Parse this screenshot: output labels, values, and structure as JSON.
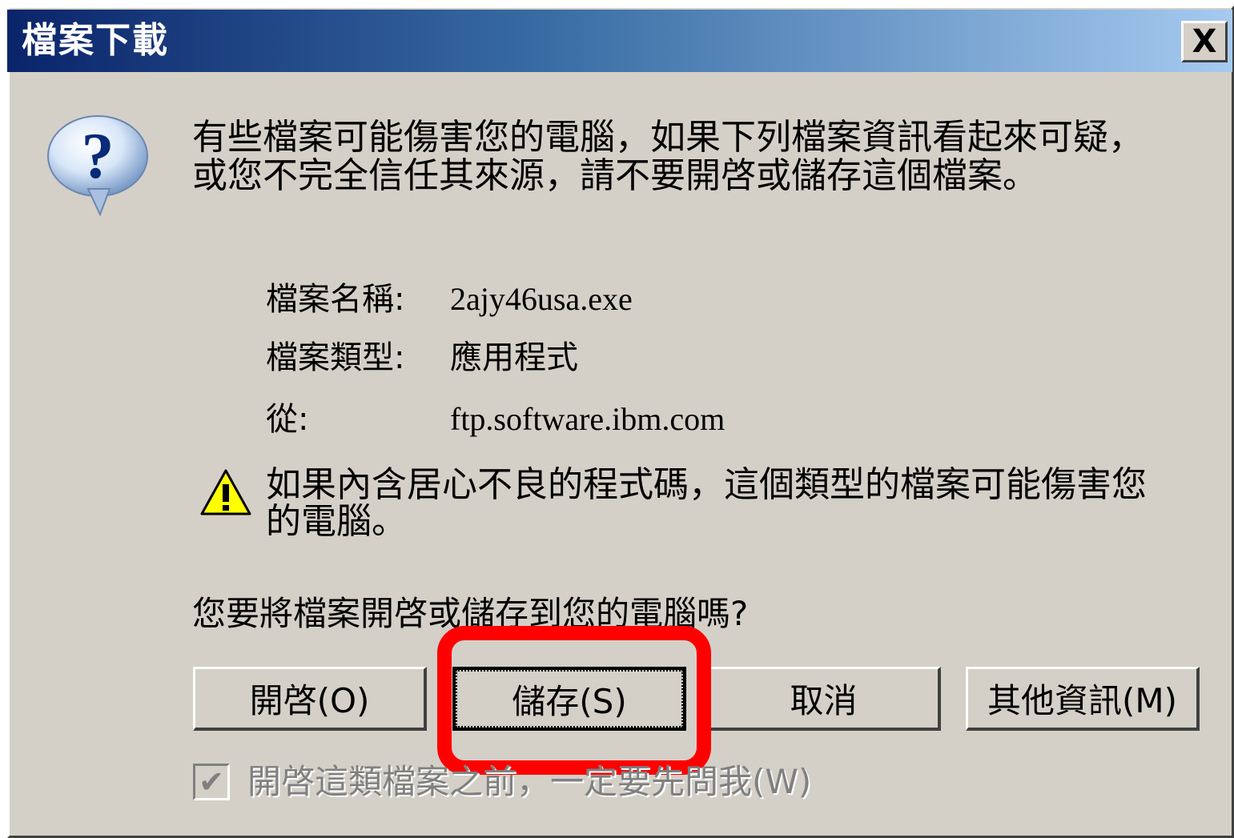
{
  "window": {
    "title": "檔案下載",
    "close_label": "X"
  },
  "intro_text": "有些檔案可能傷害您的電腦，如果下列檔案資訊看起來可疑，或您不完全信任其來源，請不要開啓或儲存這個檔案。",
  "file_info": {
    "name_label": "檔案名稱:",
    "name_value": "2ajy46usa.exe",
    "type_label": "檔案類型:",
    "type_value": "應用程式",
    "from_label": "從:",
    "from_value": "ftp.software.ibm.com"
  },
  "warning_text": "如果內含居心不良的程式碼，這個類型的檔案可能傷害您的電腦。",
  "question_text": "您要將檔案開啓或儲存到您的電腦嗎?",
  "buttons": {
    "open": "開啓(O)",
    "save": "儲存(S)",
    "cancel": "取消",
    "more_info": "其他資訊(M)"
  },
  "checkbox": {
    "label": "開啓這類檔案之前，一定要先問我(W)",
    "checked": true,
    "enabled": false
  },
  "icons": {
    "question": "question-icon",
    "warning": "warning-icon",
    "close": "close-icon"
  },
  "colors": {
    "titlebar_start": "#0a246a",
    "titlebar_end": "#a6caf0",
    "dialog_bg": "#d4d0c8",
    "highlight": "#ff0000"
  }
}
